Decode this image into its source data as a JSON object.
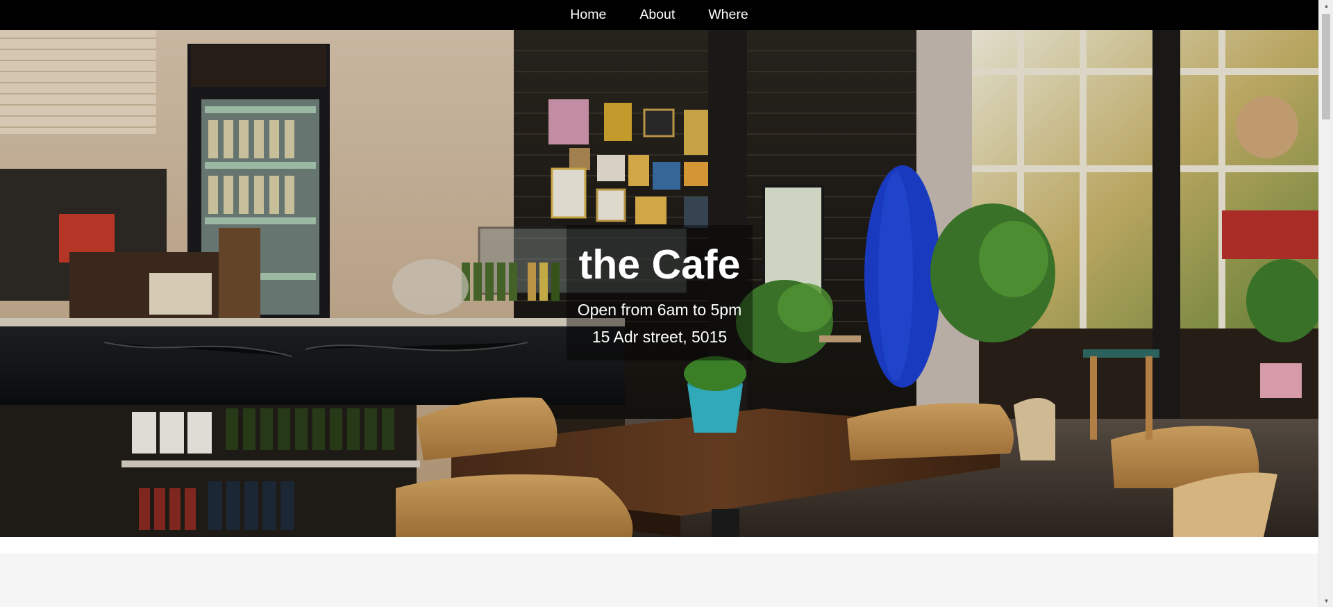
{
  "nav": {
    "items": [
      {
        "label": "Home"
      },
      {
        "label": "About"
      },
      {
        "label": "Where"
      }
    ]
  },
  "hero": {
    "title": "the Cafe",
    "hours": "Open from 6am to 5pm",
    "address": "15 Adr street, 5015",
    "background_description_icon": "cafe-interior-photo"
  },
  "colors": {
    "nav_bg": "#000000",
    "nav_text": "#ffffff",
    "overlay": "rgba(0,0,0,0.42)",
    "page_bg": "#f5f5f5"
  },
  "scrollbar": {
    "up_icon": "scroll-up-arrow-icon",
    "down_icon": "scroll-down-arrow-icon"
  }
}
